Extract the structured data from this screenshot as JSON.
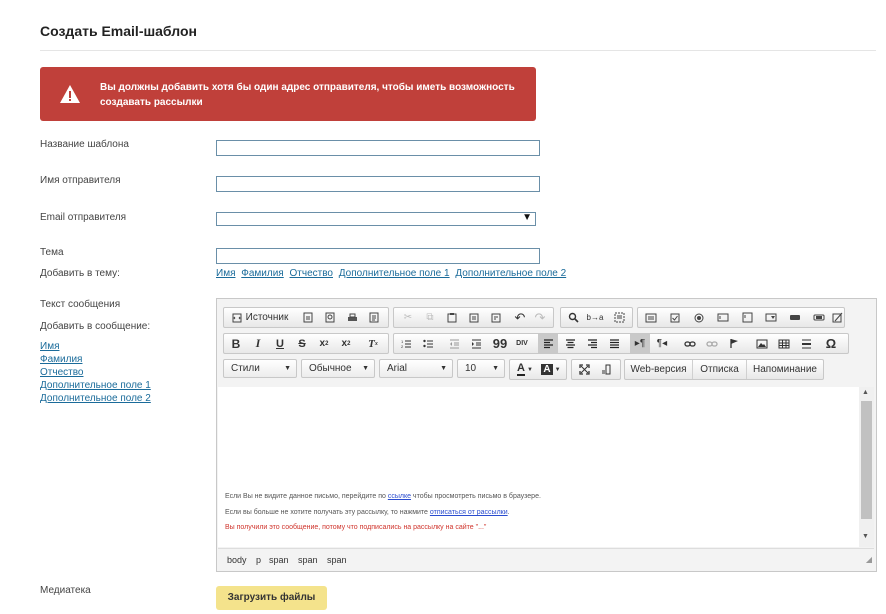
{
  "page": {
    "title": "Создать Email-шаблон"
  },
  "alert": {
    "message": "Вы должны добавить хотя бы один адрес отправителя, чтобы иметь возможность создавать рассылки",
    "color": "#c0403a"
  },
  "form": {
    "template_name_label": "Название шаблона",
    "template_name_value": "",
    "sender_name_label": "Имя отправителя",
    "sender_name_value": "",
    "sender_email_label": "Email отправителя",
    "sender_email_value": "",
    "subject_label": "Тема",
    "subject_value": "",
    "add_to_subject_label": "Добавить в тему:",
    "subject_links": [
      "Имя",
      "Фамилия",
      "Отчество",
      "Дополнительное поле 1",
      "Дополнительное поле 2"
    ],
    "message_label": "Текст сообщения",
    "add_to_message_label": "Добавить в сообщение:",
    "message_links": [
      "Имя",
      "Фамилия",
      "Отчество",
      "Дополнительное поле 1",
      "Дополнительное поле 2"
    ],
    "media_label": "Медиатека",
    "upload_button": "Загрузить файлы",
    "upload_color": "#f4e38c"
  },
  "editor": {
    "source_button": "Источник",
    "styles_dropdown": "Стили",
    "format_dropdown": "Обычное",
    "font_dropdown": "Arial",
    "size_dropdown": "10",
    "web_version_button": "Web-версия",
    "unsubscribe_button": "Отписка",
    "reminder_button": "Напоминание",
    "footer": {
      "line1_before": "Если Вы не видите данное письмо, перейдите по ",
      "line1_link": "ссылке",
      "line1_after": " чтобы просмотреть письмо в браузере.",
      "line2_before": "Если вы больше не хотите получать эту рассылку, то нажмите ",
      "line2_link": "отписаться от рассылки",
      "line2_after": ".",
      "line3": "Вы получили это сообщение, потому что подписались на рассылку на сайте \"...\""
    },
    "path": [
      "body",
      "p",
      "span",
      "span",
      "span"
    ]
  }
}
